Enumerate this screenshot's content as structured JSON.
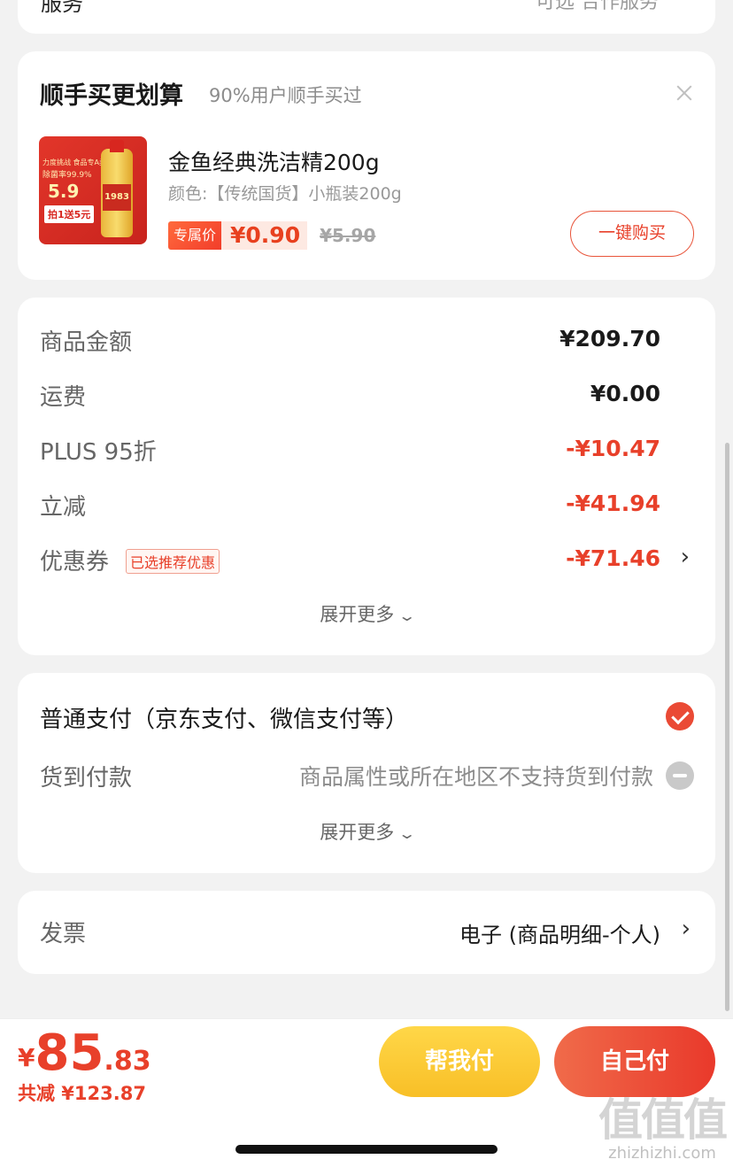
{
  "top_card": {
    "left_text": "服务",
    "right_text": "可选 合作服务"
  },
  "upsell": {
    "title": "顺手买更划算",
    "subtitle": "90%用户顺手买过",
    "product": {
      "name": "金鱼经典洗洁精200g",
      "spec": "颜色:【传统国货】小瓶装200g",
      "price_tag": "专属价",
      "price": "¥0.90",
      "original_price": "¥5.90",
      "image_texts": {
        "tag1": "力度挑战 食品专A类",
        "tag2": "除菌率99.9%",
        "price": "5.9",
        "deal": "拍1送5元",
        "label": "1983"
      }
    },
    "buy_button": "一键购买"
  },
  "summary": {
    "rows": [
      {
        "label": "商品金额",
        "value": "¥209.70"
      },
      {
        "label": "运费",
        "value": "¥0.00"
      },
      {
        "label": "PLUS 95折",
        "value": "-¥10.47"
      },
      {
        "label": "立减",
        "value": "-¥41.94"
      },
      {
        "label": "优惠券",
        "badge": "已选推荐优惠",
        "value": "-¥71.46"
      }
    ],
    "expand": "展开更多"
  },
  "payment": {
    "normal": "普通支付（京东支付、微信支付等）",
    "cod_label": "货到付款",
    "cod_note": "商品属性或所在地区不支持货到付款",
    "expand": "展开更多"
  },
  "invoice": {
    "label": "发票",
    "value": "电子 (商品明细-个人)"
  },
  "footer": {
    "currency": "¥",
    "total_int": "85",
    "total_dec": ".83",
    "saved": "共减 ¥123.87",
    "help_pay": "帮我付",
    "self_pay": "自己付"
  },
  "watermark": {
    "logo": "值值值",
    "url": "zhizhizhi.com"
  },
  "colors": {
    "accent": "#e8402a",
    "yellow_button": "#fbc933",
    "background": "#f2f2f2"
  },
  "icons": [
    "close-icon",
    "check-circle-icon",
    "disabled-circle-icon",
    "chevron-right-icon",
    "chevron-down-icon"
  ]
}
